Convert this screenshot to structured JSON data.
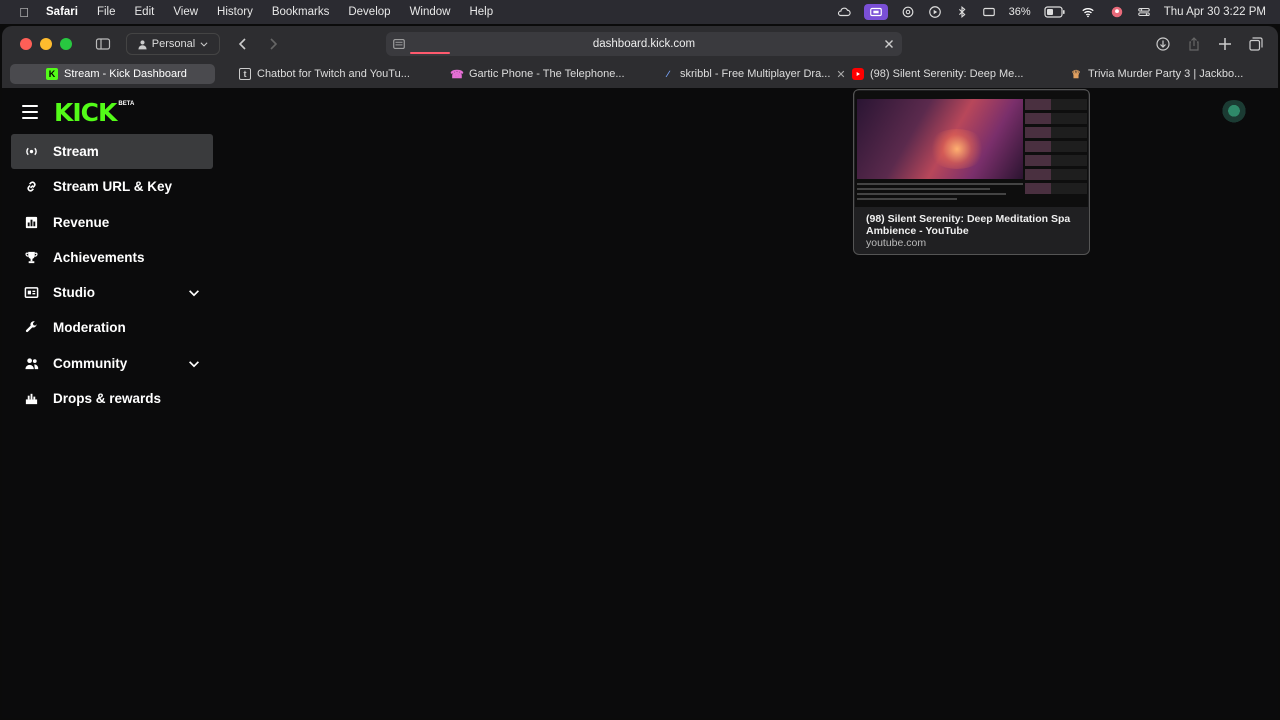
{
  "menubar": {
    "app": "Safari",
    "items": [
      "File",
      "Edit",
      "View",
      "History",
      "Bookmarks",
      "Develop",
      "Window",
      "Help"
    ],
    "battery": "36%",
    "datetime": "Thu Apr 30  3:22 PM"
  },
  "browser": {
    "profile": "Personal",
    "url": "dashboard.kick.com",
    "tabs": [
      {
        "title": "Stream - Kick Dashboard",
        "favicon": "kick-icon",
        "active": true
      },
      {
        "title": "Chatbot for Twitch and YouTu...",
        "favicon": "chatbot-icon"
      },
      {
        "title": "Gartic Phone - The Telephone...",
        "favicon": "phone-icon"
      },
      {
        "title": "skribbl - Free Multiplayer Dra...",
        "favicon": "pencil-icon"
      },
      {
        "title": "(98) Silent Serenity: Deep Me...",
        "favicon": "youtube-icon"
      },
      {
        "title": "Trivia Murder Party 3 | Jackbo...",
        "favicon": "jackbox-icon"
      }
    ]
  },
  "kick": {
    "logo": "KICK",
    "beta": "BETA",
    "nav": [
      {
        "label": "Stream",
        "icon": "stream-icon",
        "active": true
      },
      {
        "label": "Stream URL & Key",
        "icon": "link-icon"
      },
      {
        "label": "Revenue",
        "icon": "chart-icon"
      },
      {
        "label": "Achievements",
        "icon": "trophy-icon"
      },
      {
        "label": "Studio",
        "icon": "studio-icon",
        "expandable": true
      },
      {
        "label": "Moderation",
        "icon": "wrench-icon"
      },
      {
        "label": "Community",
        "icon": "people-icon",
        "expandable": true
      },
      {
        "label": "Drops & rewards",
        "icon": "gift-icon"
      }
    ]
  },
  "preview": {
    "title": "(98) Silent Serenity: Deep Meditation Spa Ambience - YouTube",
    "domain": "youtube.com"
  },
  "colors": {
    "kick_green": "#53fc18",
    "progress": "#ff5a6e",
    "youtube_red": "#ff0000"
  }
}
